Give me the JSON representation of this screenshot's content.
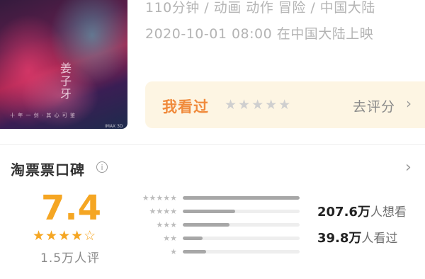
{
  "movie": {
    "poster_title": "姜子牙",
    "poster_subtitle": "十 年 一 剑 · 其 心 可 鉴",
    "poster_badge": "IMAX 3D",
    "meta_line_1": "110分钟 / 动画 动作 冒险 / 中国大陆",
    "meta_line_2": "2020-10-01 08:00 在中国大陆上映"
  },
  "watched": {
    "title": "我看过",
    "stars": "★★★★★",
    "rate_label": "去评分",
    "arrow": "›"
  },
  "reputation": {
    "title": "淘票票口碑",
    "info_icon": "i",
    "arrow": "›",
    "score": "7.4",
    "score_stars": "★★★★☆",
    "rating_count": "1.5万人评",
    "distribution": [
      {
        "stars": "★★★★★",
        "fraction": 1.0
      },
      {
        "stars": "★★★★",
        "fraction": 0.45
      },
      {
        "stars": "★★★",
        "fraction": 0.4
      },
      {
        "stars": "★★",
        "fraction": 0.17
      },
      {
        "stars": "★",
        "fraction": 0.2
      }
    ],
    "want_count": "207.6万",
    "want_label": "人想看",
    "seen_count": "39.8万",
    "seen_label": "人看过"
  },
  "colors": {
    "accent": "#f5a623",
    "watched_title": "#f08a3c",
    "watched_bg": "#fdf5e3",
    "bar_fill": "#a7a7a7",
    "bar_track": "#eeeeee"
  },
  "icons": {
    "info": "info-icon",
    "chevron": "chevron-right-icon",
    "star": "star-icon"
  }
}
